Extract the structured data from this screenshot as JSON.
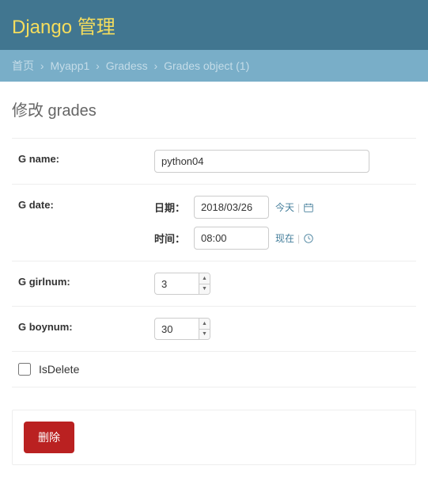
{
  "header": {
    "title": "Django 管理"
  },
  "breadcrumbs": {
    "home": "首页",
    "app": "Myapp1",
    "model": "Gradess",
    "current": "Grades object (1)"
  },
  "page": {
    "title": "修改 grades"
  },
  "fields": {
    "gname": {
      "label": "G name:",
      "value": "python04"
    },
    "gdate": {
      "label": "G date:",
      "date_sub": "日期：",
      "date_value": "2018/03/26",
      "time_sub": "时间：",
      "time_value": "08:00",
      "today": "今天",
      "now": "现在"
    },
    "ggirlnum": {
      "label": "G girlnum:",
      "value": "3"
    },
    "gboynum": {
      "label": "G boynum:",
      "value": "30"
    },
    "isdelete": {
      "label": "IsDelete"
    }
  },
  "actions": {
    "delete": "删除"
  }
}
